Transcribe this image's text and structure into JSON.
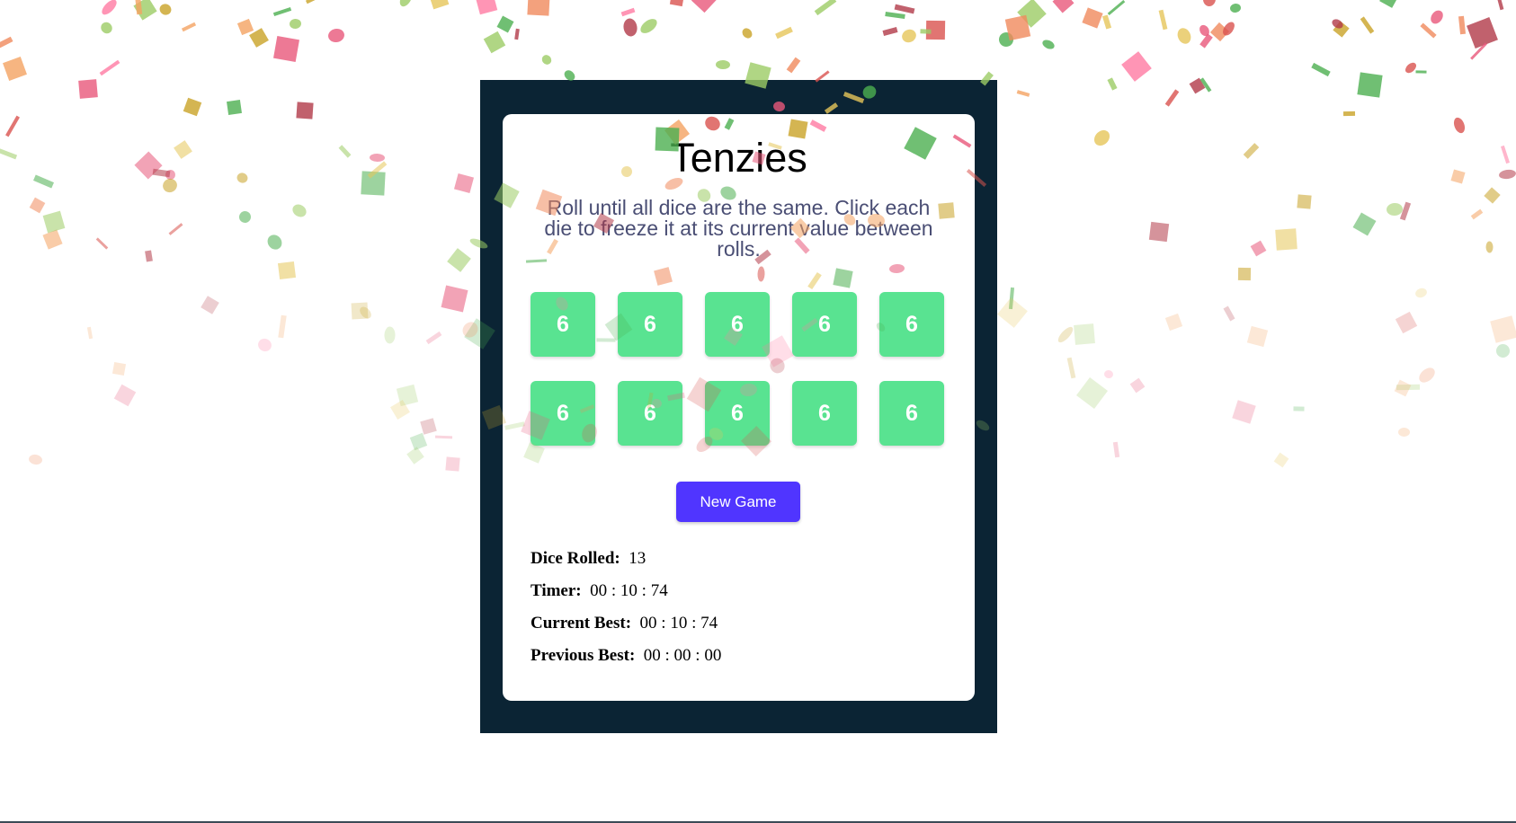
{
  "app": {
    "title": "Tenzies",
    "instructions": "Roll until all dice are the same. Click each die to freeze it at its current value between rolls."
  },
  "dice": [
    {
      "value": "6",
      "held": true
    },
    {
      "value": "6",
      "held": true
    },
    {
      "value": "6",
      "held": true
    },
    {
      "value": "6",
      "held": true
    },
    {
      "value": "6",
      "held": true
    },
    {
      "value": "6",
      "held": true
    },
    {
      "value": "6",
      "held": true
    },
    {
      "value": "6",
      "held": true
    },
    {
      "value": "6",
      "held": true
    },
    {
      "value": "6",
      "held": true
    }
  ],
  "new_game_label": "New Game",
  "stats": {
    "dice_rolled_label": "Dice Rolled:",
    "dice_rolled_value": "13",
    "timer_label": "Timer:",
    "timer_value": "00 : 10 : 74",
    "current_best_label": "Current Best:",
    "current_best_value": "00 : 10 : 74",
    "previous_best_label": "Previous Best:",
    "previous_best_value": "00 : 00 : 00"
  },
  "colors": {
    "frame": "#0b2434",
    "die_held": "#59e391",
    "button": "#5035ff",
    "instructions_text": "#4a4e74"
  }
}
